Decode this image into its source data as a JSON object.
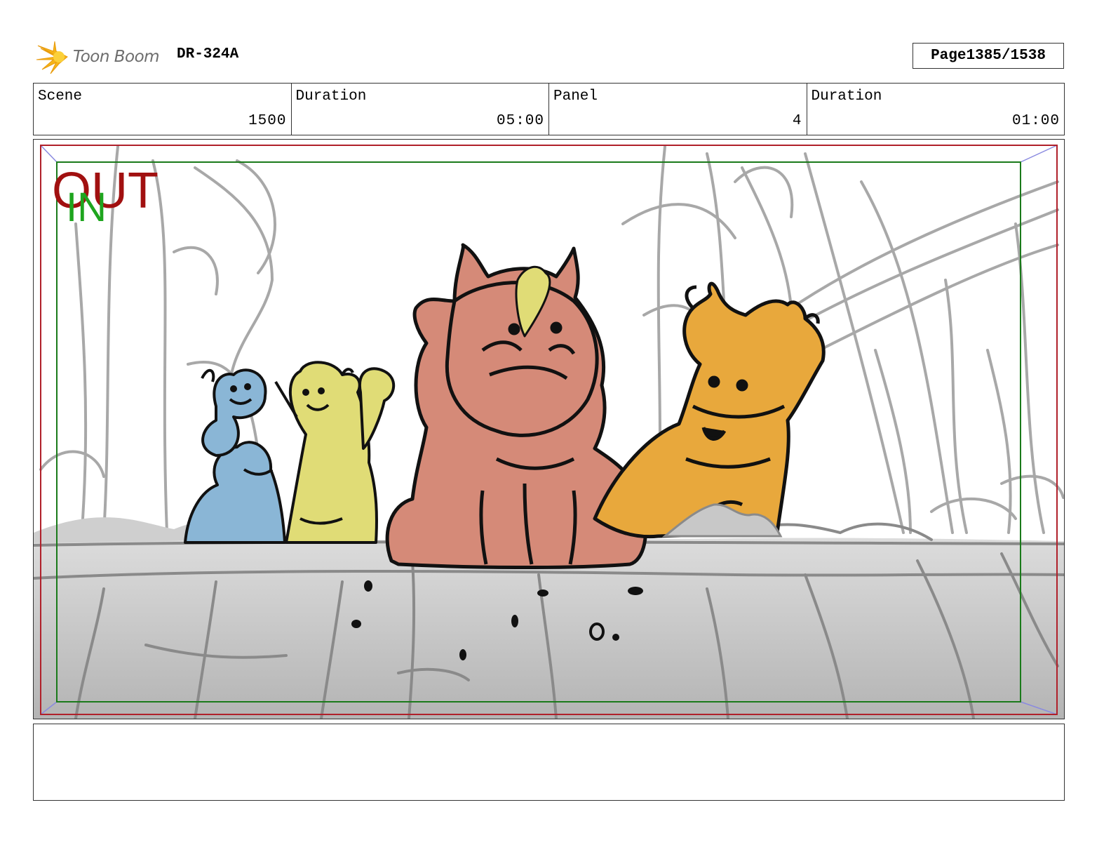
{
  "header": {
    "logo_text": "Toon Boom",
    "doc_id": "DR-324A",
    "page_label": "Page",
    "page_value": "1385/1538"
  },
  "info": {
    "scene_label": "Scene",
    "scene_value": "1500",
    "duration1_label": "Duration",
    "duration1_value": "05:00",
    "panel_label": "Panel",
    "panel_value": "4",
    "duration2_label": "Duration",
    "duration2_value": "01:00"
  },
  "frame": {
    "out_marker": "OUT",
    "in_marker": "IN"
  },
  "colors": {
    "out_marker": "#a11010",
    "in_marker": "#1ea51e",
    "safe_frame_outer": "#b0202a",
    "safe_frame_inner": "#1a7a1a",
    "character_blue": "#8ab6d6",
    "character_yellow": "#e0dc76",
    "character_red": "#d58a78",
    "character_orange": "#e8a83c"
  },
  "notes": {
    "text": ""
  }
}
